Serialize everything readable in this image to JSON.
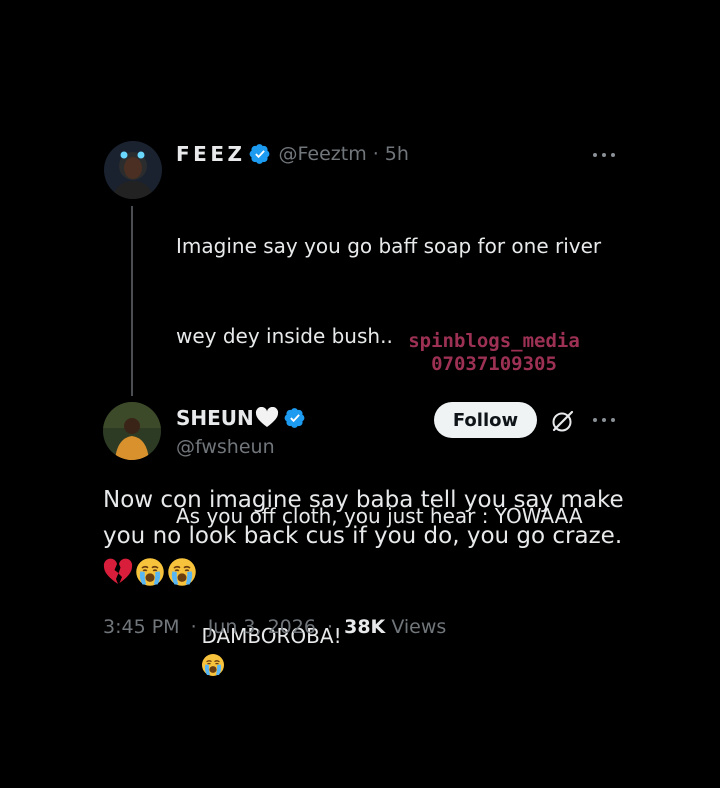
{
  "parent_tweet": {
    "display_name": "FEEZ",
    "handle": "@Feeztm",
    "separator": "·",
    "time": "5h",
    "line1": "Imagine say you go baff soap for one river",
    "line2": "wey dey inside bush..",
    "line3": "As you off cloth, you just hear : YOWAAA",
    "line4": "DAMBOROBA!"
  },
  "watermark": {
    "line1": "spinblogs_media",
    "line2": "07037109305"
  },
  "reply_tweet": {
    "display_name": "SHEUN",
    "handle": "@fwsheun",
    "follow_label": "Follow",
    "line1": "Now con imagine say baba tell you say make",
    "line2": "you no look back cus if you do, you go craze.",
    "timestamp": "3:45 PM",
    "separator": "·",
    "date": "Jun 3, 2026",
    "views_count": "38K",
    "views_label": "Views"
  },
  "icons": {
    "verified": "verified-badge-icon",
    "more": "more-options-icon",
    "grok": "grok-icon",
    "emoji_cry": "loudly-crying-face-emoji",
    "emoji_heart_white": "white-heart-emoji",
    "emoji_broken_heart": "broken-heart-emoji"
  },
  "colors": {
    "background": "#000000",
    "text_primary": "#e7e9ea",
    "text_secondary": "#71767b",
    "verified_blue": "#1d9bf0",
    "follow_button_bg": "#eff3f4",
    "watermark": "#b83a63"
  }
}
